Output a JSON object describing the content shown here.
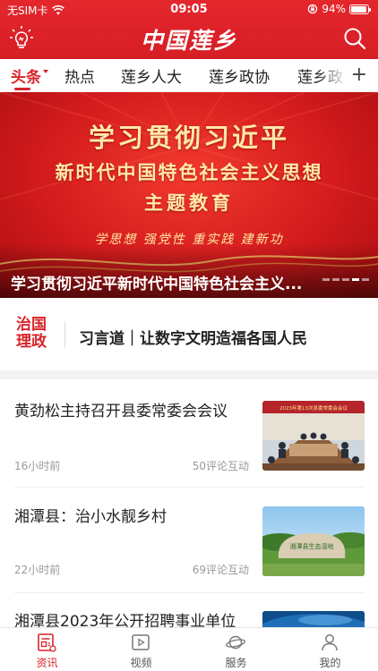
{
  "status_bar": {
    "carrier": "无SIM卡",
    "time": "09:05",
    "battery_text": "94%",
    "battery_level": 0.94
  },
  "header": {
    "app_logo": "中国莲乡",
    "left_icon": "lightbulb-icon",
    "right_icon": "search-icon"
  },
  "tabs": {
    "items": [
      {
        "label": "头条",
        "active": true
      },
      {
        "label": "热点",
        "active": false
      },
      {
        "label": "莲乡人大",
        "active": false
      },
      {
        "label": "莲乡政协",
        "active": false
      },
      {
        "label": "莲乡政",
        "active": false
      }
    ],
    "add_label": "+"
  },
  "banner": {
    "line1": "学习贯彻习近平",
    "line2": "新时代中国特色社会主义思想",
    "line3": "主题教育",
    "slogans": "学思想  强党性  重实践  建新功",
    "caption": "学习贯彻习近平新时代中国特色社会主义...",
    "slide_count": 5,
    "active_slide": 4
  },
  "governance": {
    "badge_line1": "治国",
    "badge_line2": "理政",
    "headline": "习言道｜让数字文明造福各国人民"
  },
  "news": [
    {
      "title": "黄劲松主持召开县委常委会会议",
      "time": "16小时前",
      "comments": "50评论互动",
      "thumb_caption": "2023年第13次县委常委会会议"
    },
    {
      "title": "湘潭县：治小水靓乡村",
      "time": "22小时前",
      "comments": "69评论互动",
      "thumb_caption": "湘潭县生态湿地"
    },
    {
      "title": "湘潭县2023年公开招聘事业单位",
      "time": "",
      "comments": "",
      "thumb_caption": ""
    }
  ],
  "bottom_nav": [
    {
      "label": "资讯",
      "icon": "news-icon",
      "active": true
    },
    {
      "label": "视频",
      "icon": "video-icon",
      "active": false
    },
    {
      "label": "服务",
      "icon": "planet-icon",
      "active": false
    },
    {
      "label": "我的",
      "icon": "person-icon",
      "active": false
    }
  ],
  "colors": {
    "brand_red": "#d8242a",
    "text": "#222222",
    "muted": "#999999"
  }
}
